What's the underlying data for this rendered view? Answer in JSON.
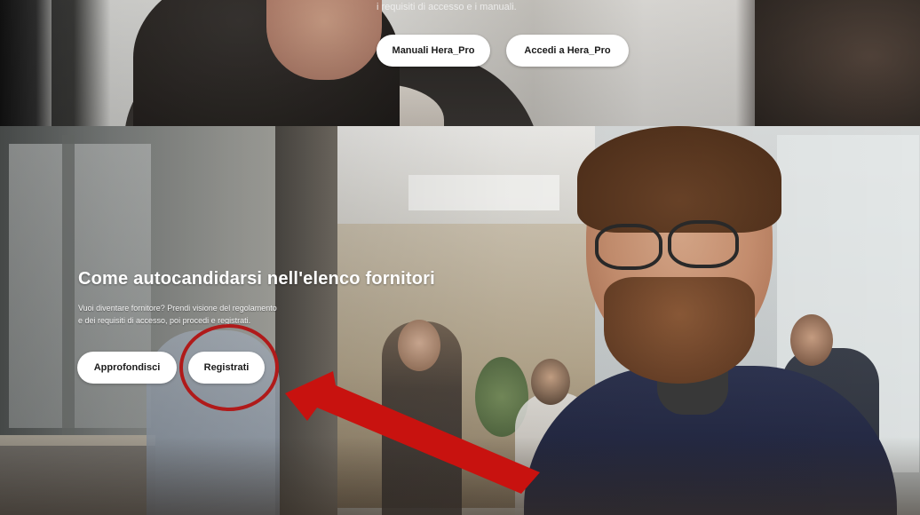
{
  "top_section": {
    "caption": "i requisiti di accesso e i manuali.",
    "buttons": [
      "Manuali Hera_Pro",
      "Accedi a Hera_Pro"
    ]
  },
  "hero": {
    "title": "Come autocandidarsi nell'elenco fornitori",
    "description_line1": "Vuoi diventare fornitore? Prendi visione del regolamento",
    "description_line2": "e dei requisiti di accesso, poi procedi e registrati.",
    "buttons": [
      "Approfondisci",
      "Registrati"
    ]
  },
  "annotation": {
    "circle_color": "#b01a1a",
    "arrow_color": "#c8120f"
  }
}
